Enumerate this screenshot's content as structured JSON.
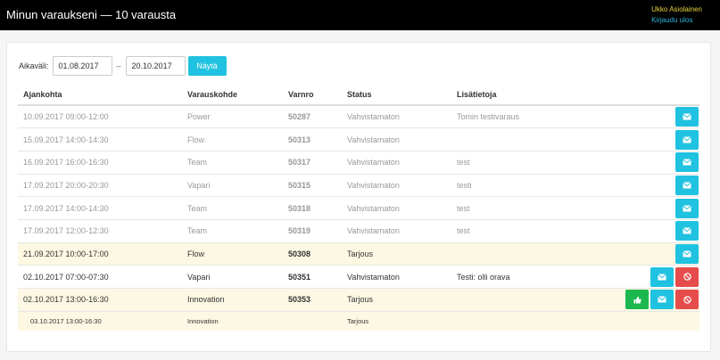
{
  "header": {
    "title": "Minun varaukseni — 10 varausta",
    "user_name": "Ukko Asiolainen",
    "logout_label": "Kirjaudu ulos"
  },
  "filter": {
    "label": "Aikaväli:",
    "start_date": "01.08.2017",
    "separator": "–",
    "end_date": "20.10.2017",
    "show_button": "Näytä"
  },
  "table": {
    "columns": [
      "Ajankohta",
      "Varauskohde",
      "Varnro",
      "Status",
      "Lisätietoja"
    ],
    "rows": [
      {
        "time": "10.09.2017 09:00-12:00",
        "target": "Power",
        "varnro": "50287",
        "status": "Vahvistamaton",
        "info": "Tomin testivaraus"
      },
      {
        "time": "15.09.2017 14:00-14:30",
        "target": "Flow",
        "varnro": "50313",
        "status": "Vahvistamaton",
        "info": ""
      },
      {
        "time": "16.09.2017 16:00-16:30",
        "target": "Team",
        "varnro": "50317",
        "status": "Vahvistamaton",
        "info": "test"
      },
      {
        "time": "17.09.2017 20:00-20:30",
        "target": "Vapari",
        "varnro": "50315",
        "status": "Vahvistamaton",
        "info": "testi"
      },
      {
        "time": "17.09.2017 14:00-14:30",
        "target": "Team",
        "varnro": "50318",
        "status": "Vahvistamaton",
        "info": "test"
      },
      {
        "time": "17.09.2017 12:00-12:30",
        "target": "Team",
        "varnro": "50319",
        "status": "Vahvistamaton",
        "info": "test"
      },
      {
        "time": "21.09.2017 10:00-17:00",
        "target": "Flow",
        "varnro": "50308",
        "status": "Tarjous",
        "info": ""
      },
      {
        "time": "02.10.2017 07:00-07:30",
        "target": "Vapari",
        "varnro": "50351",
        "status": "Vahvistamaton",
        "info": "Testi: olli orava"
      },
      {
        "time": "02.10.2017 13:00-16:30",
        "target": "Innovation",
        "varnro": "50353",
        "status": "Tarjous",
        "info": ""
      }
    ],
    "subrow": {
      "time": "03.10.2017 13:00-16:30",
      "target": "Innovation",
      "status": "Tarjous"
    }
  },
  "icons": {
    "mail": "envelope-icon",
    "cancel": "ban-icon",
    "accept": "thumbs-up-icon"
  },
  "colors": {
    "topbar": "#000000",
    "user_name": "#e8d33a",
    "logout": "#2ab8dd",
    "info_button": "#1fc2e0",
    "danger_button": "#e74c4c",
    "success_button": "#1cb84f",
    "offer_row": "#fcf8e3"
  }
}
